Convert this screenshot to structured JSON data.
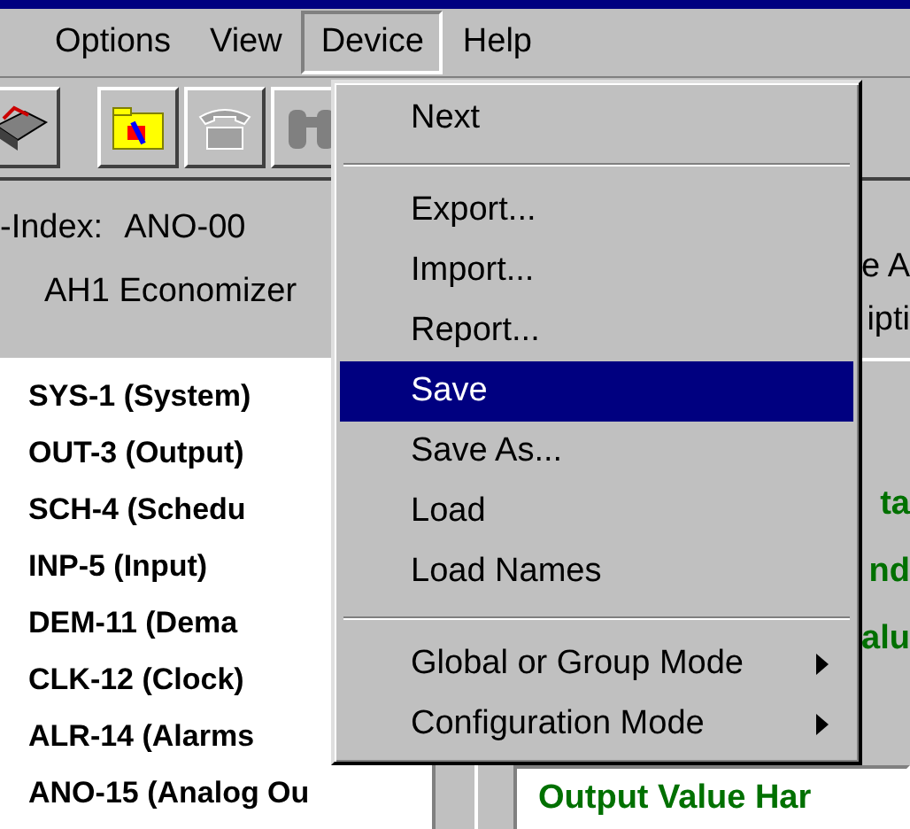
{
  "menu_bar": [
    {
      "label": "Options",
      "selected": false
    },
    {
      "label": "View",
      "selected": false
    },
    {
      "label": "Device",
      "selected": true
    },
    {
      "label": "Help",
      "selected": false
    }
  ],
  "header": {
    "index_label": "-Index:",
    "index_value": "ANO-00",
    "name": "AH1 Economizer",
    "right_line_1": "e A",
    "right_line_2": "ipti"
  },
  "object_list": [
    {
      "label": "SYS-1 (System)"
    },
    {
      "label": "OUT-3 (Output)"
    },
    {
      "label": "SCH-4 (Schedu"
    },
    {
      "label": "INP-5 (Input)"
    },
    {
      "label": "DEM-11 (Dema"
    },
    {
      "label": "CLK-12 (Clock)"
    },
    {
      "label": "ALR-14 (Alarms"
    },
    {
      "label": "ANO-15 (Analog Ou"
    }
  ],
  "detail_labels": [
    {
      "label": "ta"
    },
    {
      "label": "nd"
    },
    {
      "label": "alu"
    }
  ],
  "detail_box": {
    "label": "Output Value Har"
  },
  "device_menu": [
    {
      "kind": "item",
      "label": "Next",
      "selected": false
    },
    {
      "kind": "separator"
    },
    {
      "kind": "item",
      "label": "Export...",
      "selected": false
    },
    {
      "kind": "item",
      "label": "Import...",
      "selected": false
    },
    {
      "kind": "item",
      "label": "Report...",
      "selected": false
    },
    {
      "kind": "item",
      "label": "Save",
      "selected": true
    },
    {
      "kind": "item",
      "label": "Save As...",
      "selected": false
    },
    {
      "kind": "item",
      "label": "Load",
      "selected": false
    },
    {
      "kind": "item",
      "label": "Load Names",
      "selected": false
    },
    {
      "kind": "separator"
    },
    {
      "kind": "submenu",
      "label": "Global or Group Mode",
      "selected": false
    },
    {
      "kind": "submenu",
      "label": "Configuration Mode",
      "selected": false
    }
  ]
}
